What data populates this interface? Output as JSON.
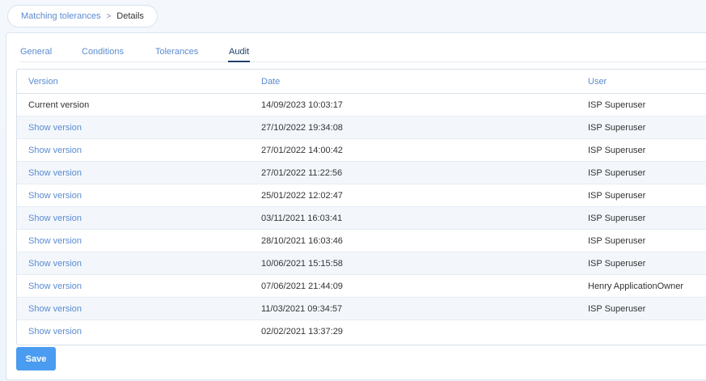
{
  "breadcrumb": {
    "parent": "Matching tolerances",
    "separator": ">",
    "current": "Details"
  },
  "tabs": [
    {
      "label": "General",
      "active": false
    },
    {
      "label": "Conditions",
      "active": false
    },
    {
      "label": "Tolerances",
      "active": false
    },
    {
      "label": "Audit",
      "active": true
    }
  ],
  "grid": {
    "columns": [
      "Version",
      "Date",
      "User"
    ],
    "rows": [
      {
        "version": "Current version",
        "date": "14/09/2023 10:03:17",
        "user": "ISP Superuser"
      },
      {
        "version": "Show version",
        "date": "27/10/2022 19:34:08",
        "user": "ISP Superuser"
      },
      {
        "version": "Show version",
        "date": "27/01/2022 14:00:42",
        "user": "ISP Superuser"
      },
      {
        "version": "Show version",
        "date": "27/01/2022 11:22:56",
        "user": "ISP Superuser"
      },
      {
        "version": "Show version",
        "date": "25/01/2022 12:02:47",
        "user": "ISP Superuser"
      },
      {
        "version": "Show version",
        "date": "03/11/2021 16:03:41",
        "user": "ISP Superuser"
      },
      {
        "version": "Show version",
        "date": "28/10/2021 16:03:46",
        "user": "ISP Superuser"
      },
      {
        "version": "Show version",
        "date": "10/06/2021 15:15:58",
        "user": "ISP Superuser"
      },
      {
        "version": "Show version",
        "date": "07/06/2021 21:44:09",
        "user": "Henry ApplicationOwner"
      },
      {
        "version": "Show version",
        "date": "11/03/2021 09:34:57",
        "user": "ISP Superuser"
      },
      {
        "version": "Show version",
        "date": "02/02/2021 13:37:29",
        "user": ""
      }
    ]
  },
  "actions": {
    "save_label": "Save"
  },
  "colors": {
    "accent": "#4a9cf0",
    "link": "#5b8bd0",
    "active_tab": "#1f3f6b",
    "alt_row": "#f3f7fc"
  }
}
